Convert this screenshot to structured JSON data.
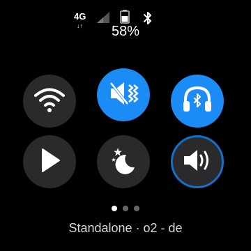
{
  "status": {
    "network_type": "4G",
    "data_arrows": "↓↑",
    "battery_percent": "58%",
    "bluetooth": "bluetooth-icon",
    "signal": "signal-icon",
    "battery_icon": "battery-icon"
  },
  "tiles": [
    {
      "name": "wifi",
      "icon": "wifi-icon",
      "state": "off"
    },
    {
      "name": "sound-mode-vibrate",
      "icon": "mute-vibrate-icon",
      "state": "on"
    },
    {
      "name": "bluetooth-audio",
      "icon": "bluetooth-headphones-icon",
      "state": "on"
    },
    {
      "name": "play-media",
      "icon": "play-icon",
      "state": "off"
    },
    {
      "name": "do-not-disturb",
      "icon": "moon-stars-icon",
      "state": "off"
    },
    {
      "name": "volume",
      "icon": "volume-icon",
      "state": "focused"
    }
  ],
  "pagination": {
    "pages": 3,
    "current": 1
  },
  "carrier": "Standalone · o2 - de",
  "colors": {
    "accent": "#1b8bf5",
    "tile_off": "#2a2a2c",
    "focus_ring": "#1470c7"
  }
}
